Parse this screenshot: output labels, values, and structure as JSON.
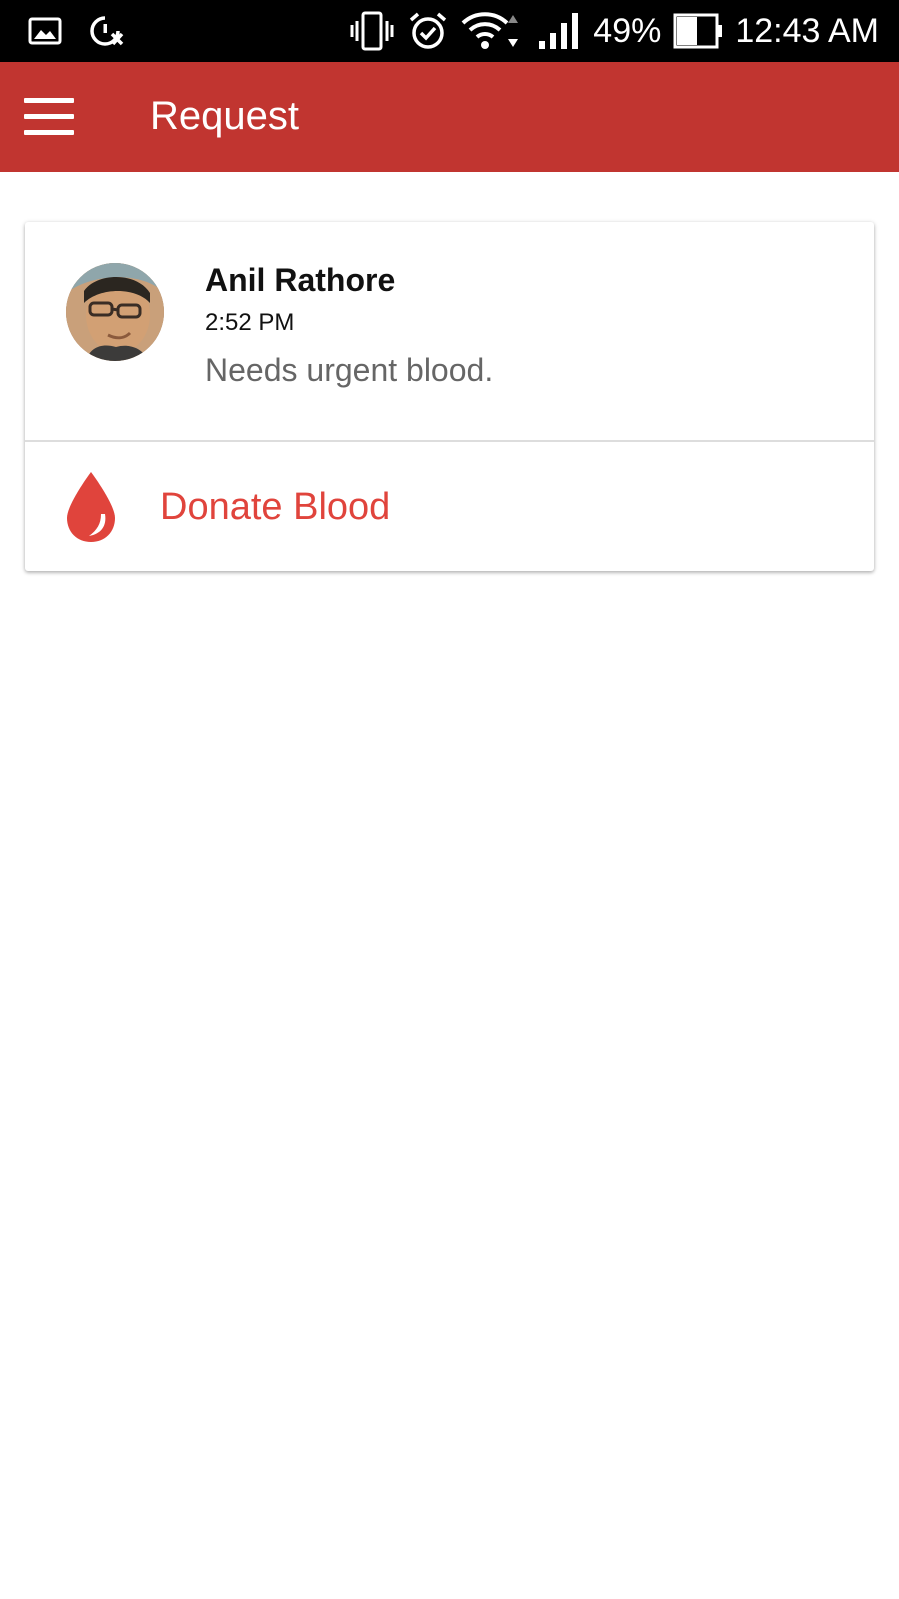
{
  "status_bar": {
    "battery": "49%",
    "time": "12:43 AM",
    "icons": [
      "gallery-icon",
      "data-saver-icon",
      "vibrate-icon",
      "alarm-icon",
      "wifi-icon",
      "signal-icon",
      "battery-icon"
    ]
  },
  "app_bar": {
    "title": "Request",
    "menu_icon": "hamburger-menu-icon",
    "color": "#C13530"
  },
  "request_card": {
    "requester_name": "Anil Rathore",
    "time": "2:52 PM",
    "message": "Needs urgent blood.",
    "action_label": "Donate Blood",
    "action_icon": "blood-drop-icon",
    "accent_color": "#E0443C"
  }
}
